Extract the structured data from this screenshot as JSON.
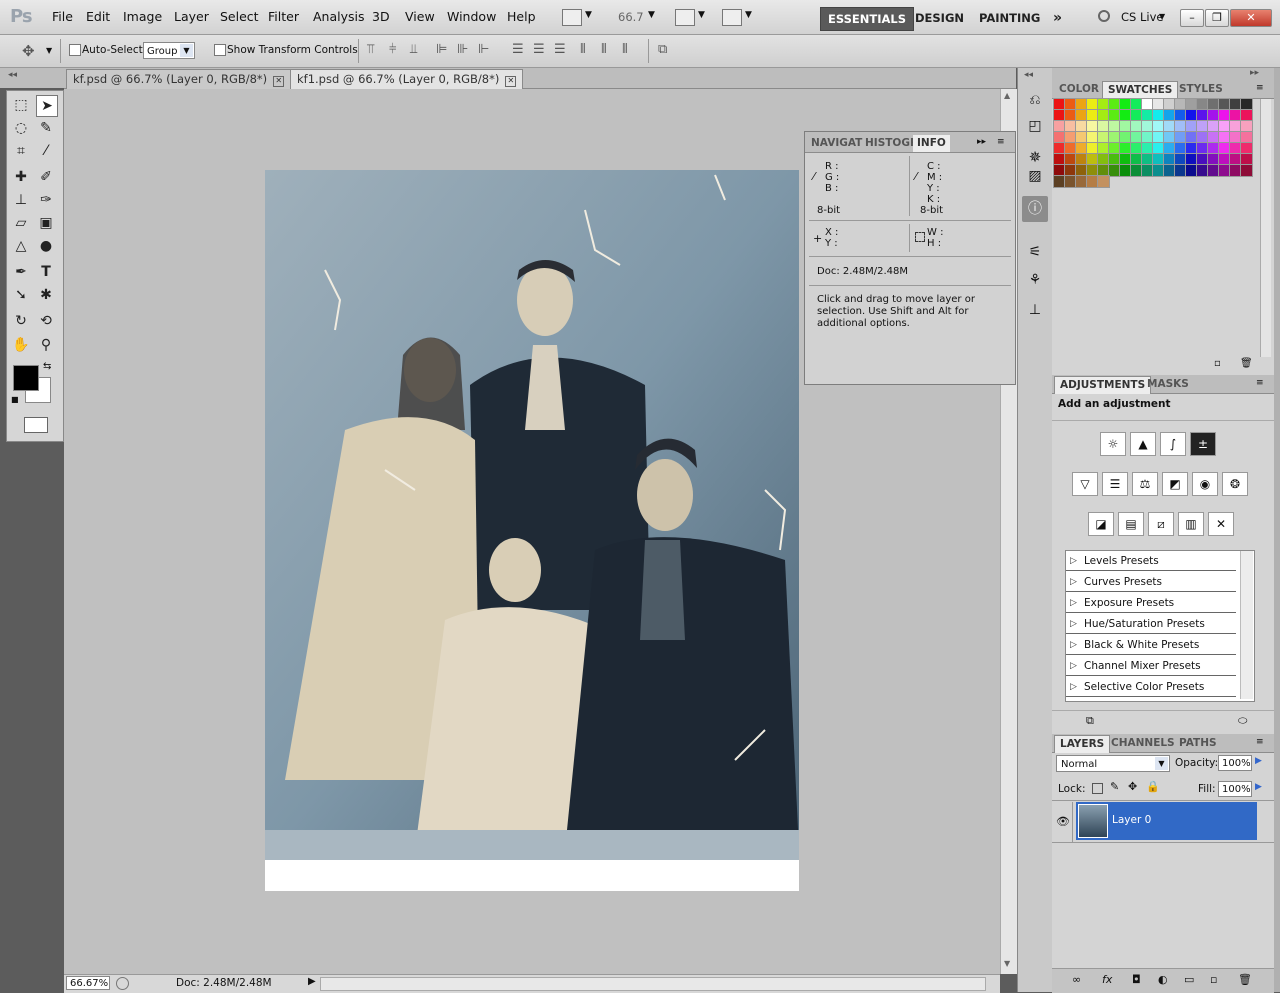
{
  "app": {
    "logo": "Ps"
  },
  "menu": [
    "File",
    "Edit",
    "Image",
    "Layer",
    "Select",
    "Filter",
    "Analysis",
    "3D",
    "View",
    "Window",
    "Help"
  ],
  "zoom_field": "66.7",
  "workspaces": {
    "essentials": "ESSENTIALS",
    "design": "DESIGN",
    "painting": "PAINTING",
    "more": "»",
    "cslive": "CS Live"
  },
  "options": {
    "auto_select_label": "Auto-Select:",
    "auto_select_value": "Group",
    "transform_label": "Show Transform Controls"
  },
  "tabs": [
    {
      "label": "kf.psd @ 66.7% (Layer 0, RGB/8*)"
    },
    {
      "label": "kf1.psd @ 66.7% (Layer 0, RGB/8*)"
    }
  ],
  "status": {
    "zoom": "66.67%",
    "doc": "Doc: 2.48M/2.48M"
  },
  "info_panel": {
    "tabs": [
      "NAVIGAT",
      "HISTOGR",
      "INFO"
    ],
    "rgb": [
      "R :",
      "G :",
      "B :"
    ],
    "cmyk": [
      "C :",
      "M :",
      "Y :",
      "K :"
    ],
    "bit_left": "8-bit",
    "bit_right": "8-bit",
    "xy": [
      "X :",
      "Y :"
    ],
    "wh": [
      "W :",
      "H :"
    ],
    "doc": "Doc: 2.48M/2.48M",
    "hint": "Click and drag to move layer or selection.  Use Shift and Alt for additional options."
  },
  "swatches_panel": {
    "tabs": [
      "COLOR",
      "SWATCHES",
      "STYLES"
    ]
  },
  "adjustments": {
    "tabs": [
      "ADJUSTMENTS",
      "MASKS"
    ],
    "title": "Add an adjustment",
    "presets": [
      "Levels Presets",
      "Curves Presets",
      "Exposure Presets",
      "Hue/Saturation Presets",
      "Black & White Presets",
      "Channel Mixer Presets",
      "Selective Color Presets"
    ]
  },
  "layers": {
    "tabs": [
      "LAYERS",
      "CHANNELS",
      "PATHS"
    ],
    "blend": "Normal",
    "opacity_label": "Opacity:",
    "opacity": "100%",
    "lock_label": "Lock:",
    "fill_label": "Fill:",
    "fill": "100%",
    "layer_name": "Layer 0"
  },
  "colors": {
    "accent": "#3169c6",
    "fg": "#000000",
    "bg": "#ffffff"
  }
}
